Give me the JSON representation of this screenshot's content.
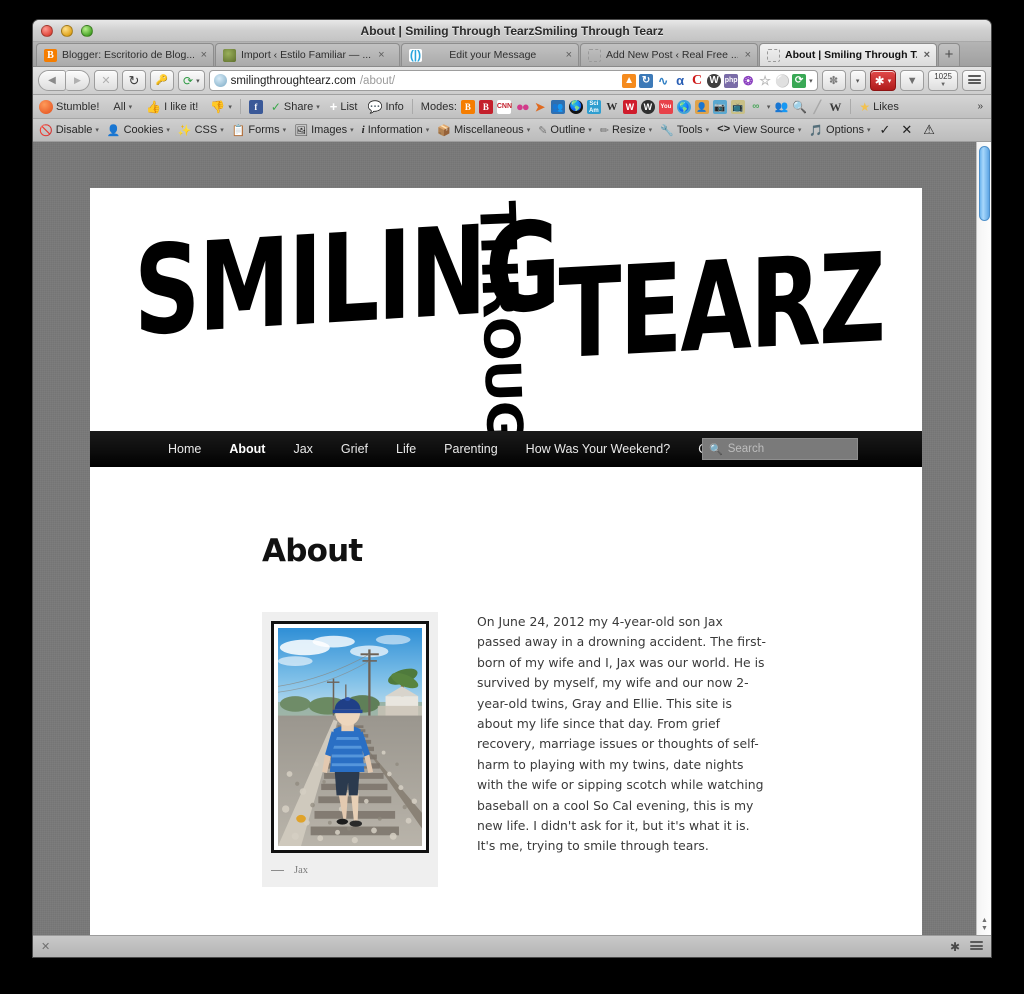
{
  "window": {
    "title": "About | Smiling Through TearzSmiling Through Tearz",
    "traffic_lights": [
      "close",
      "minimize",
      "zoom"
    ]
  },
  "tabs": [
    {
      "title": "Blogger: Escritorio de Blog...",
      "favicon": "blogger-icon",
      "active": false,
      "close_label": "×"
    },
    {
      "title": "Import ‹ Estilo Familiar — ...",
      "favicon": "wordpress-icon",
      "active": false,
      "close_label": "×"
    },
    {
      "title": "Edit your Message",
      "favicon": "message-icon",
      "active": false,
      "close_label": "×"
    },
    {
      "title": "Add New Post ‹ Real Free ...",
      "favicon": "blank-icon",
      "active": false,
      "close_label": "×"
    },
    {
      "title": "About | Smiling Through T...",
      "favicon": "blank-icon",
      "active": true,
      "close_label": "×"
    }
  ],
  "new_tab_label": "+",
  "navbar": {
    "back_label": "◀",
    "forward_label": "▶",
    "stop_label": "✕",
    "reload_label": "↻",
    "key_label": "🔑",
    "sync_label": "⟳",
    "sync_caret": "▾",
    "url_host": "smilingthroughtearz.com",
    "url_path": "/about/",
    "url_icons": [
      "chart-icon",
      "refresh-icon",
      "wave-icon",
      "alpha-icon",
      "c-icon",
      "wordpress-icon",
      "php-icon",
      "pen-icon",
      "star-icon",
      "shield-icon",
      "green-sync-icon",
      "chevron-down-icon"
    ],
    "right_icons": [
      "feather-icon",
      "caret-down-icon",
      "asterisk-icon",
      "caret-down-2-icon",
      "downloads-icon",
      "counter-icon",
      "stack-icon"
    ],
    "counter_value": "1025"
  },
  "stumblebar": {
    "brand": "Stumble!",
    "items": [
      "All",
      "I like it!",
      "Share",
      "List",
      "Info"
    ],
    "modes_label": "Modes:",
    "likes_label": "Likes",
    "overflow_label": "»"
  },
  "devbar": {
    "items": [
      "Disable",
      "Cookies",
      "CSS",
      "Forms",
      "Images",
      "Information",
      "Miscellaneous",
      "Outline",
      "Resize",
      "Tools",
      "View Source",
      "Options"
    ],
    "check_label": "✓",
    "cross_label": "✕",
    "warn_label": "⚠"
  },
  "site": {
    "logo": {
      "word1": "SMILING",
      "word2": "THROUGH",
      "word3": "TEARZ"
    },
    "nav": [
      {
        "label": "Home",
        "current": false
      },
      {
        "label": "About",
        "current": true
      },
      {
        "label": "Jax",
        "current": false
      },
      {
        "label": "Grief",
        "current": false
      },
      {
        "label": "Life",
        "current": false
      },
      {
        "label": "Parenting",
        "current": false
      },
      {
        "label": "How Was Your Weekend?",
        "current": false
      },
      {
        "label": "Contact",
        "current": false
      }
    ],
    "search_placeholder": "Search",
    "search_icon": "search-icon",
    "page_title": "About",
    "figure": {
      "caption_dash": "—",
      "caption": "Jax",
      "alt": "Young boy in blue cap and striped shirt walking away down railroad tracks"
    },
    "body": "On June 24, 2012 my 4-year-old son Jax passed away in a drowning accident. The first-born of my wife and I, Jax was our world. He is survived by myself, my wife and our now 2-year-old twins, Gray and Ellie. This site is about my life since that day. From grief recovery, marriage issues or thoughts of self-harm to playing with my twins, date nights with the wife or sipping scotch while watching baseball on a cool So Cal evening, this is my new life. I didn't ask for it, but it's what it is. It's me, trying to smile through tears."
  },
  "statusbar": {
    "close_label": "✕",
    "right_icons": [
      "firefox-pin-icon",
      "stack-icon"
    ]
  },
  "colors": {
    "desktop": "#7d7d7d",
    "site_bg": "#ffffff",
    "nav_bg": "#000000",
    "accent_blue": "#6db4ee",
    "figure_bg": "#efefef",
    "text": "#3a3a3a"
  }
}
